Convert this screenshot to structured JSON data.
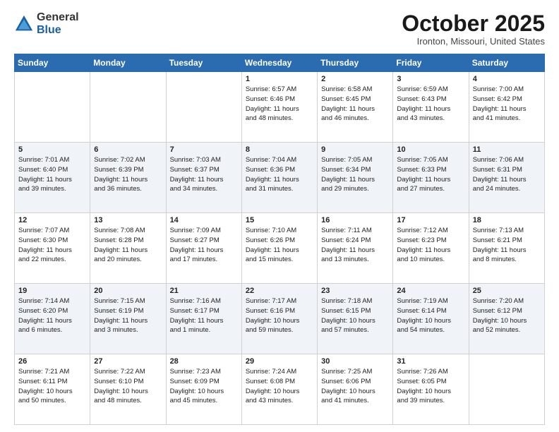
{
  "logo": {
    "general": "General",
    "blue": "Blue"
  },
  "header": {
    "month": "October 2025",
    "location": "Ironton, Missouri, United States"
  },
  "weekdays": [
    "Sunday",
    "Monday",
    "Tuesday",
    "Wednesday",
    "Thursday",
    "Friday",
    "Saturday"
  ],
  "weeks": [
    [
      {
        "day": "",
        "info": ""
      },
      {
        "day": "",
        "info": ""
      },
      {
        "day": "",
        "info": ""
      },
      {
        "day": "1",
        "info": "Sunrise: 6:57 AM\nSunset: 6:46 PM\nDaylight: 11 hours\nand 48 minutes."
      },
      {
        "day": "2",
        "info": "Sunrise: 6:58 AM\nSunset: 6:45 PM\nDaylight: 11 hours\nand 46 minutes."
      },
      {
        "day": "3",
        "info": "Sunrise: 6:59 AM\nSunset: 6:43 PM\nDaylight: 11 hours\nand 43 minutes."
      },
      {
        "day": "4",
        "info": "Sunrise: 7:00 AM\nSunset: 6:42 PM\nDaylight: 11 hours\nand 41 minutes."
      }
    ],
    [
      {
        "day": "5",
        "info": "Sunrise: 7:01 AM\nSunset: 6:40 PM\nDaylight: 11 hours\nand 39 minutes."
      },
      {
        "day": "6",
        "info": "Sunrise: 7:02 AM\nSunset: 6:39 PM\nDaylight: 11 hours\nand 36 minutes."
      },
      {
        "day": "7",
        "info": "Sunrise: 7:03 AM\nSunset: 6:37 PM\nDaylight: 11 hours\nand 34 minutes."
      },
      {
        "day": "8",
        "info": "Sunrise: 7:04 AM\nSunset: 6:36 PM\nDaylight: 11 hours\nand 31 minutes."
      },
      {
        "day": "9",
        "info": "Sunrise: 7:05 AM\nSunset: 6:34 PM\nDaylight: 11 hours\nand 29 minutes."
      },
      {
        "day": "10",
        "info": "Sunrise: 7:05 AM\nSunset: 6:33 PM\nDaylight: 11 hours\nand 27 minutes."
      },
      {
        "day": "11",
        "info": "Sunrise: 7:06 AM\nSunset: 6:31 PM\nDaylight: 11 hours\nand 24 minutes."
      }
    ],
    [
      {
        "day": "12",
        "info": "Sunrise: 7:07 AM\nSunset: 6:30 PM\nDaylight: 11 hours\nand 22 minutes."
      },
      {
        "day": "13",
        "info": "Sunrise: 7:08 AM\nSunset: 6:28 PM\nDaylight: 11 hours\nand 20 minutes."
      },
      {
        "day": "14",
        "info": "Sunrise: 7:09 AM\nSunset: 6:27 PM\nDaylight: 11 hours\nand 17 minutes."
      },
      {
        "day": "15",
        "info": "Sunrise: 7:10 AM\nSunset: 6:26 PM\nDaylight: 11 hours\nand 15 minutes."
      },
      {
        "day": "16",
        "info": "Sunrise: 7:11 AM\nSunset: 6:24 PM\nDaylight: 11 hours\nand 13 minutes."
      },
      {
        "day": "17",
        "info": "Sunrise: 7:12 AM\nSunset: 6:23 PM\nDaylight: 11 hours\nand 10 minutes."
      },
      {
        "day": "18",
        "info": "Sunrise: 7:13 AM\nSunset: 6:21 PM\nDaylight: 11 hours\nand 8 minutes."
      }
    ],
    [
      {
        "day": "19",
        "info": "Sunrise: 7:14 AM\nSunset: 6:20 PM\nDaylight: 11 hours\nand 6 minutes."
      },
      {
        "day": "20",
        "info": "Sunrise: 7:15 AM\nSunset: 6:19 PM\nDaylight: 11 hours\nand 3 minutes."
      },
      {
        "day": "21",
        "info": "Sunrise: 7:16 AM\nSunset: 6:17 PM\nDaylight: 11 hours\nand 1 minute."
      },
      {
        "day": "22",
        "info": "Sunrise: 7:17 AM\nSunset: 6:16 PM\nDaylight: 10 hours\nand 59 minutes."
      },
      {
        "day": "23",
        "info": "Sunrise: 7:18 AM\nSunset: 6:15 PM\nDaylight: 10 hours\nand 57 minutes."
      },
      {
        "day": "24",
        "info": "Sunrise: 7:19 AM\nSunset: 6:14 PM\nDaylight: 10 hours\nand 54 minutes."
      },
      {
        "day": "25",
        "info": "Sunrise: 7:20 AM\nSunset: 6:12 PM\nDaylight: 10 hours\nand 52 minutes."
      }
    ],
    [
      {
        "day": "26",
        "info": "Sunrise: 7:21 AM\nSunset: 6:11 PM\nDaylight: 10 hours\nand 50 minutes."
      },
      {
        "day": "27",
        "info": "Sunrise: 7:22 AM\nSunset: 6:10 PM\nDaylight: 10 hours\nand 48 minutes."
      },
      {
        "day": "28",
        "info": "Sunrise: 7:23 AM\nSunset: 6:09 PM\nDaylight: 10 hours\nand 45 minutes."
      },
      {
        "day": "29",
        "info": "Sunrise: 7:24 AM\nSunset: 6:08 PM\nDaylight: 10 hours\nand 43 minutes."
      },
      {
        "day": "30",
        "info": "Sunrise: 7:25 AM\nSunset: 6:06 PM\nDaylight: 10 hours\nand 41 minutes."
      },
      {
        "day": "31",
        "info": "Sunrise: 7:26 AM\nSunset: 6:05 PM\nDaylight: 10 hours\nand 39 minutes."
      },
      {
        "day": "",
        "info": ""
      }
    ]
  ]
}
